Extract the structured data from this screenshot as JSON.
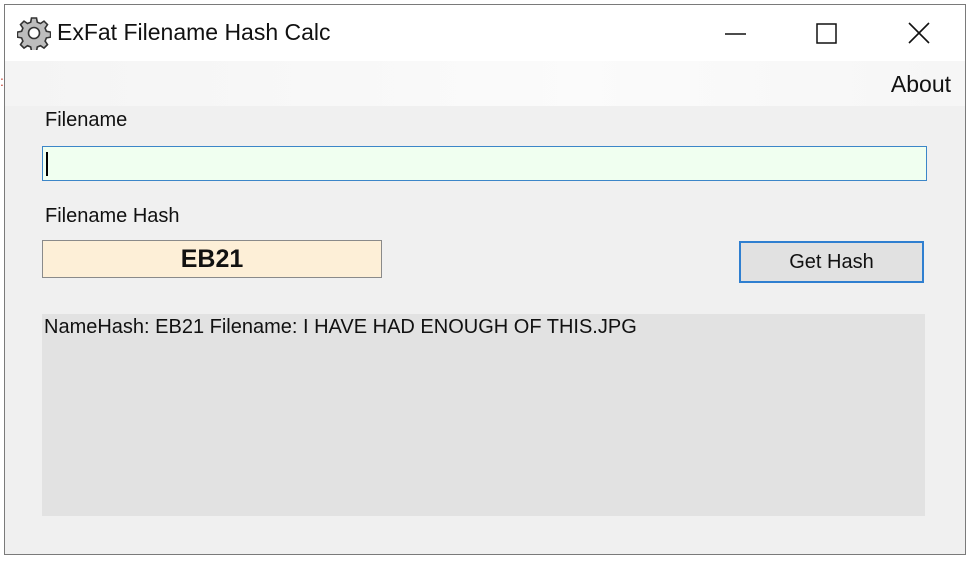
{
  "window": {
    "title": "ExFat Filename Hash Calc",
    "icons": {
      "app": "gear-icon",
      "minimize": "minimize-icon",
      "maximize": "maximize-icon",
      "close": "close-icon"
    }
  },
  "menu": {
    "about_label": "About"
  },
  "form": {
    "filename_label": "Filename",
    "filename_value": "",
    "hash_label": "Filename Hash",
    "hash_value": "EB21",
    "get_hash_label": "Get Hash"
  },
  "output": {
    "lines": [
      "NameHash: EB21 Filename: I HAVE HAD ENOUGH OF THIS.JPG"
    ]
  },
  "colors": {
    "input_bg": "#f0fff0",
    "input_border": "#3c86c8",
    "hash_bg": "#fdefd7",
    "button_border": "#2f7fd0",
    "output_bg": "#e2e2e2"
  }
}
